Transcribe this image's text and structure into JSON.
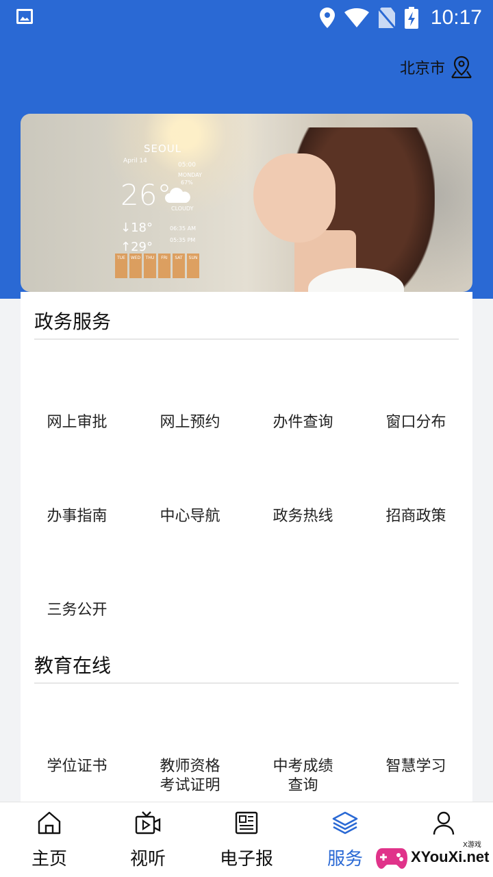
{
  "status_bar": {
    "time": "10:17",
    "icons": [
      "image-icon",
      "location-pin-icon",
      "wifi-icon",
      "no-sim-icon",
      "battery-charging-icon"
    ]
  },
  "header": {
    "city": "北京市",
    "location_icon": "map-pin-icon",
    "background": "#2a69d4"
  },
  "banner": {
    "weather": {
      "city": "SEOUL",
      "date": "April 14",
      "time": "05:00",
      "day": "MONDAY",
      "humidity": "67%",
      "temp": "26°",
      "condition": "CLOUDY",
      "low": "↓18°",
      "high": "↑29°",
      "sunrise": "06:35 AM",
      "sunset": "05:35 PM",
      "days": [
        "TUE",
        "WED",
        "THU",
        "FRI",
        "SAT",
        "SUN"
      ]
    }
  },
  "sections": [
    {
      "title": "政务服务",
      "items": [
        "网上审批",
        "网上预约",
        "办件查询",
        "窗口分布",
        "办事指南",
        "中心导航",
        "政务热线",
        "招商政策",
        "三务公开"
      ]
    },
    {
      "title": "教育在线",
      "items": [
        "学位证书",
        "教师资格\n考试证明",
        "中考成绩\n查询",
        "智慧学习"
      ]
    }
  ],
  "bottom_nav": {
    "active": "服务",
    "active_color": "#2a69d4",
    "items": [
      {
        "label": "主页",
        "icon": "home-icon"
      },
      {
        "label": "视听",
        "icon": "video-icon"
      },
      {
        "label": "电子报",
        "icon": "newspaper-icon"
      },
      {
        "label": "服务",
        "icon": "layers-icon"
      },
      {
        "label": "",
        "icon": "user-icon"
      }
    ]
  },
  "watermark": {
    "text": "XYouXi.net",
    "small": "X游戏"
  }
}
